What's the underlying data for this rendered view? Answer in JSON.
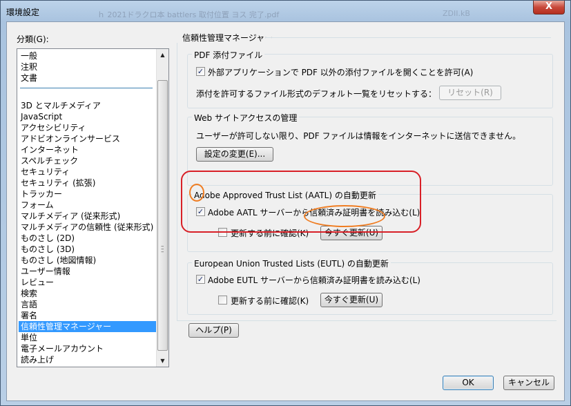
{
  "window": {
    "title": "環境設定",
    "close_label": "X",
    "background_ghost": "ｈ 2021ドラクロ本 battlers 取付位置 ヨス 完了.pdf",
    "background_ghost_right": "ZDII.kB"
  },
  "categories": {
    "label": "分類(G):",
    "items": [
      "一般",
      "注釈",
      "文書",
      "3D とマルチメディア",
      "JavaScript",
      "アクセシビリティ",
      "アドビオンラインサービス",
      "インターネット",
      "スペルチェック",
      "セキュリティ",
      "セキュリティ (拡張)",
      "トラッカー",
      "フォーム",
      "マルチメディア (従来形式)",
      "マルチメディアの信頼性 (従来形式)",
      "ものさし (2D)",
      "ものさし (3D)",
      "ものさし (地図情報)",
      "ユーザー情報",
      "レビュー",
      "検索",
      "言語",
      "署名",
      "信頼性管理マネージャー",
      "単位",
      "電子メールアカウント",
      "読み上げ"
    ],
    "selected": "信頼性管理マネージャー"
  },
  "main": {
    "title": "信頼性管理マネージャー",
    "pdf_attachments": {
      "title": "PDF 添付ファイル",
      "allow_external_label": "外部アプリケーションで PDF 以外の添付ファイルを開くことを許可(A)",
      "allow_external_checked": true,
      "reset_text": "添付を許可するファイル形式のデフォルト一覧をリセットする：",
      "reset_button": "リセット(R)"
    },
    "web_access": {
      "title": "Web サイトアクセスの管理",
      "description": "ユーザーが許可しない限り、PDF ファイルは情報をインターネットに送信できません。",
      "change_settings_button": "設定の変更(E)..."
    },
    "aatl": {
      "title": "Adobe Approved Trust List (AATL) の自動更新",
      "load_label": "Adobe AATL サーバーから信頼済み証明書を読み込む(L)",
      "load_checked": true,
      "confirm_label": "更新する前に確認(K)",
      "confirm_checked": false,
      "update_now_button": "今すぐ更新(U)"
    },
    "eutl": {
      "title": "European Union Trusted Lists (EUTL) の自動更新",
      "load_label": "Adobe EUTL サーバーから信頼済み証明書を読み込む(L)",
      "load_checked": true,
      "confirm_label": "更新する前に確認(K)",
      "confirm_checked": false,
      "update_now_button": "今すぐ更新(U)"
    },
    "help_button": "ヘルプ(P)"
  },
  "footer": {
    "ok_button": "OK",
    "cancel_button": "キャンセル"
  },
  "annotations": {
    "highlight_color": "#d81f26",
    "ring_color": "#ef7d22"
  }
}
